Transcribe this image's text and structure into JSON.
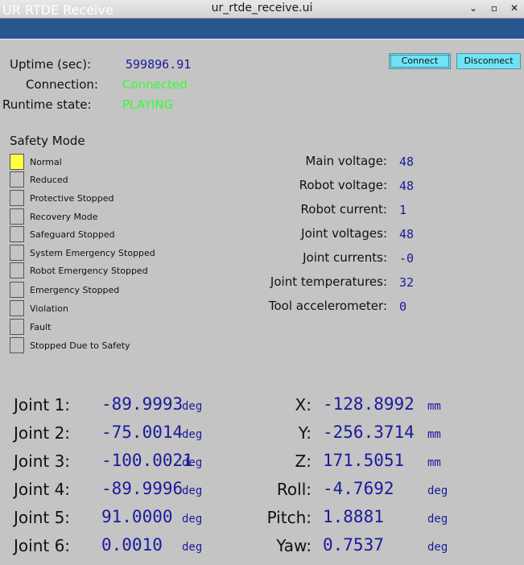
{
  "window": {
    "title": "ur_rtde_receive.ui",
    "minimize": "⌄",
    "maximize": "▫",
    "close": "✕"
  },
  "header": {
    "title": "UR RTDE Receive"
  },
  "status": {
    "uptime_label": "Uptime (sec):",
    "uptime_value": "599896.91",
    "connection_label": "Connection:",
    "connection_value": "Connected",
    "runtime_label": "Runtime state:",
    "runtime_value": "PLAYING"
  },
  "buttons": {
    "connect": "Connect",
    "disconnect": "Disconnect"
  },
  "safety": {
    "title": "Safety Mode",
    "active_index": 0,
    "active_color": "#ffff44",
    "modes": [
      "Normal",
      "Reduced",
      "Protective Stopped",
      "Recovery Mode",
      "Safeguard Stopped",
      "System Emergency Stopped",
      "Robot Emergency Stopped",
      "Emergency Stopped",
      "Violation",
      "Fault",
      "Stopped Due to Safety"
    ]
  },
  "robot": [
    {
      "label": "Main voltage:",
      "value": "48"
    },
    {
      "label": "Robot voltage:",
      "value": "48"
    },
    {
      "label": "Robot current:",
      "value": "1"
    },
    {
      "label": "Joint voltages:",
      "value": "48"
    },
    {
      "label": "Joint currents:",
      "value": "-0"
    },
    {
      "label": "Joint temperatures:",
      "value": "32"
    },
    {
      "label": "Tool accelerometer:",
      "value": "0"
    }
  ],
  "joints": [
    {
      "label": "Joint 1:",
      "value": "-89.9993",
      "unit": "deg"
    },
    {
      "label": "Joint 2:",
      "value": "-75.0014",
      "unit": "deg"
    },
    {
      "label": "Joint 3:",
      "value": "-100.0021",
      "unit": "deg"
    },
    {
      "label": "Joint 4:",
      "value": "-89.9996",
      "unit": "deg"
    },
    {
      "label": "Joint 5:",
      "value": "91.0000",
      "unit": "deg"
    },
    {
      "label": "Joint 6:",
      "value": "0.0010",
      "unit": "deg"
    }
  ],
  "pose": [
    {
      "label": "X:",
      "value": "-128.8992",
      "unit": "mm"
    },
    {
      "label": "Y:",
      "value": "-256.3714",
      "unit": "mm"
    },
    {
      "label": "Z:",
      "value": "171.5051",
      "unit": "mm"
    },
    {
      "label": "Roll:",
      "value": "-4.7692",
      "unit": "deg"
    },
    {
      "label": "Pitch:",
      "value": "1.8881",
      "unit": "deg"
    },
    {
      "label": "Yaw:",
      "value": "0.7537",
      "unit": "deg"
    }
  ]
}
